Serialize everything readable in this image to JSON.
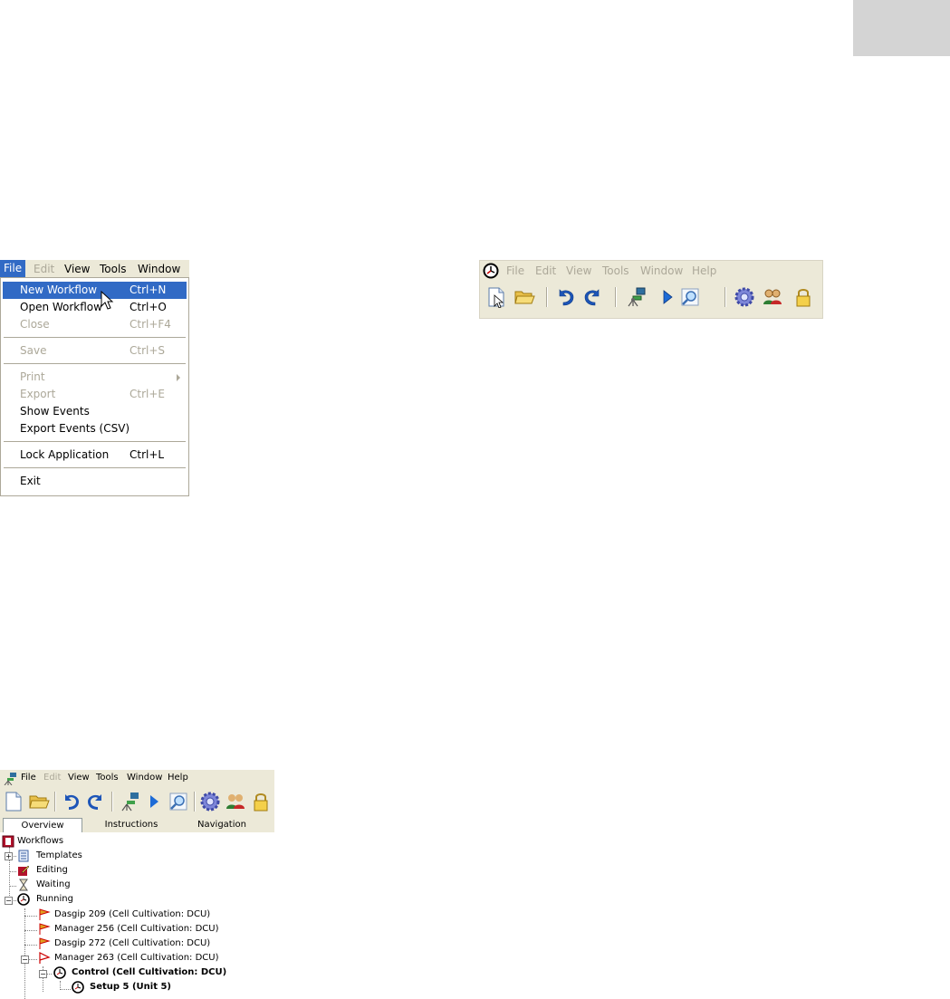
{
  "file_menu": {
    "menubar": [
      "File",
      "Edit",
      "View",
      "Tools",
      "Window"
    ],
    "items": [
      {
        "label": "New Workflow",
        "shortcut": "Ctrl+N"
      },
      {
        "label": "Open Workflow",
        "shortcut": "Ctrl+O"
      },
      {
        "label": "Close",
        "shortcut": "Ctrl+F4"
      },
      {
        "label": "Save",
        "shortcut": "Ctrl+S"
      },
      {
        "label": "Print",
        "shortcut": ""
      },
      {
        "label": "Export",
        "shortcut": "Ctrl+E"
      },
      {
        "label": "Show Events",
        "shortcut": ""
      },
      {
        "label": "Export Events (CSV)",
        "shortcut": ""
      },
      {
        "label": "Lock Application",
        "shortcut": "Ctrl+L"
      },
      {
        "label": "Exit",
        "shortcut": ""
      }
    ]
  },
  "toolbar_panel": {
    "menubar": [
      "File",
      "Edit",
      "View",
      "Tools",
      "Window",
      "Help"
    ]
  },
  "app": {
    "menubar": [
      "File",
      "Edit",
      "View",
      "Tools",
      "Window",
      "Help"
    ],
    "tabs": [
      "Overview",
      "Instructions",
      "Navigation"
    ],
    "tree": [
      "Workflows",
      "Templates",
      "Editing",
      "Waiting",
      "Running",
      "Dasgip 209 (Cell Cultivation: DCU)",
      "Manager 256 (Cell Cultivation: DCU)",
      "Dasgip 272 (Cell Cultivation: DCU)",
      "Manager 263 (Cell Cultivation: DCU)",
      "Control (Cell Cultivation: DCU)",
      "Setup 5 (Unit 5)"
    ]
  },
  "colors": {
    "highlight": "#316ac5",
    "menubar_bg": "#ece9d8",
    "disabled": "#aca899"
  }
}
